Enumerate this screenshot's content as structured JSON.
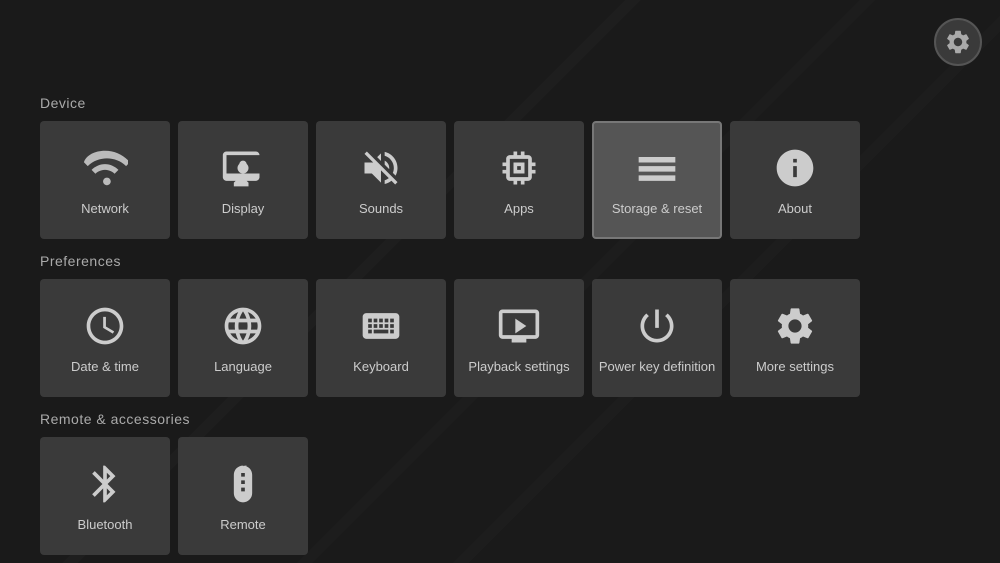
{
  "gear": {
    "label": "Settings gear"
  },
  "sections": {
    "device": {
      "label": "Device",
      "tiles": [
        {
          "id": "network",
          "label": "Network",
          "icon": "wifi"
        },
        {
          "id": "display",
          "label": "Display",
          "icon": "display"
        },
        {
          "id": "sounds",
          "label": "Sounds",
          "icon": "sounds"
        },
        {
          "id": "apps",
          "label": "Apps",
          "icon": "apps"
        },
        {
          "id": "storage-reset",
          "label": "Storage & reset",
          "icon": "storage",
          "active": true
        },
        {
          "id": "about",
          "label": "About",
          "icon": "info"
        }
      ]
    },
    "preferences": {
      "label": "Preferences",
      "tiles": [
        {
          "id": "date-time",
          "label": "Date & time",
          "icon": "clock"
        },
        {
          "id": "language",
          "label": "Language",
          "icon": "globe"
        },
        {
          "id": "keyboard",
          "label": "Keyboard",
          "icon": "keyboard"
        },
        {
          "id": "playback-settings",
          "label": "Playback settings",
          "icon": "playback"
        },
        {
          "id": "power-key-definition",
          "label": "Power key definition",
          "icon": "power"
        },
        {
          "id": "more-settings",
          "label": "More settings",
          "icon": "gear"
        }
      ]
    },
    "remote": {
      "label": "Remote & accessories",
      "tiles": [
        {
          "id": "bluetooth",
          "label": "Bluetooth",
          "icon": "bluetooth"
        },
        {
          "id": "remote",
          "label": "Remote",
          "icon": "remote"
        }
      ]
    }
  }
}
